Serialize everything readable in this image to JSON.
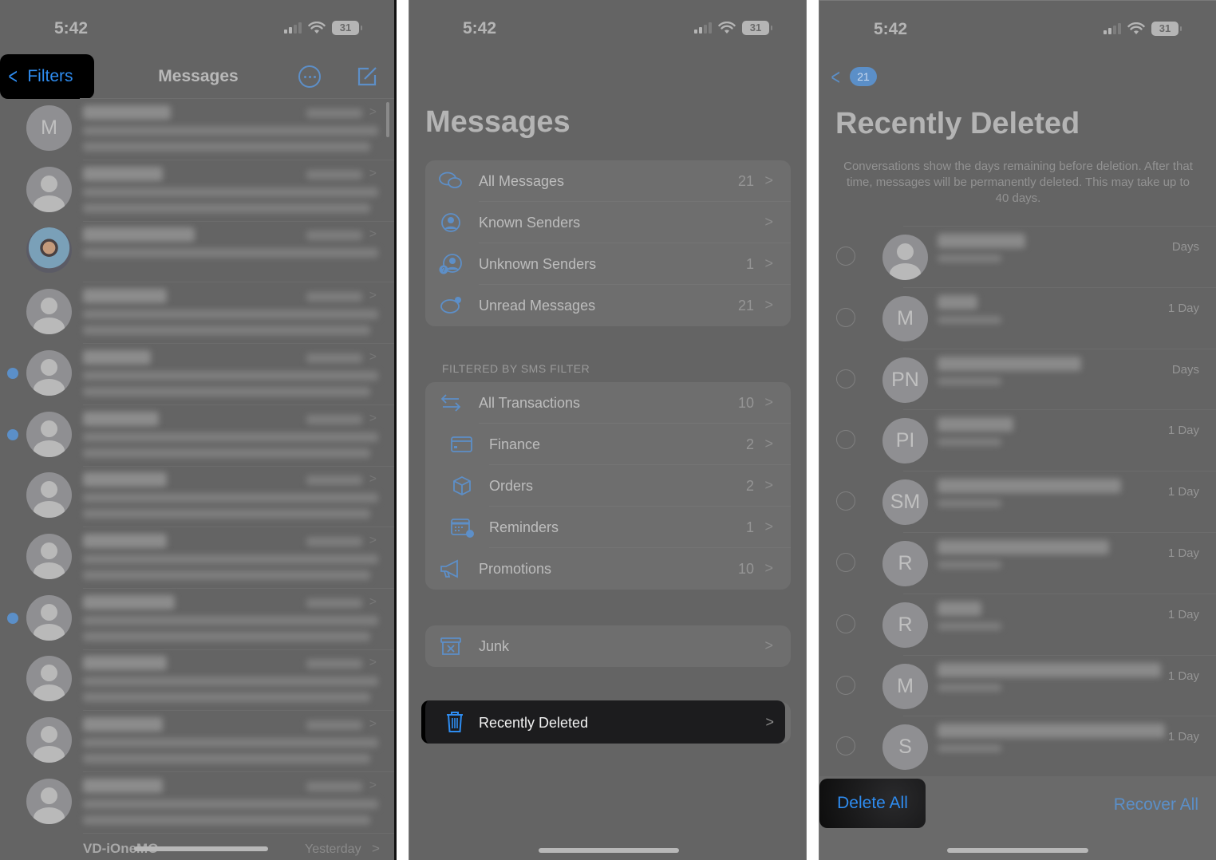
{
  "status_bar": {
    "time": "5:42",
    "battery": "31"
  },
  "panel1": {
    "back_label": "Filters",
    "title": "Messages",
    "conversations": [
      {
        "avatar": "M",
        "unread": false,
        "photo": false
      },
      {
        "avatar": "",
        "unread": false,
        "photo": false
      },
      {
        "avatar": "",
        "unread": false,
        "photo": true
      },
      {
        "avatar": "",
        "unread": false,
        "photo": false
      },
      {
        "avatar": "",
        "unread": true,
        "photo": false
      },
      {
        "avatar": "",
        "unread": true,
        "photo": false
      },
      {
        "avatar": "",
        "unread": false,
        "photo": false
      },
      {
        "avatar": "",
        "unread": false,
        "photo": false
      },
      {
        "avatar": "",
        "unread": true,
        "photo": false
      },
      {
        "avatar": "",
        "unread": false,
        "photo": false
      },
      {
        "avatar": "",
        "unread": false,
        "photo": false
      },
      {
        "avatar": "",
        "unread": false,
        "photo": false
      }
    ],
    "last_visible": {
      "name": "VD-iOneMO",
      "time": "Yesterday"
    }
  },
  "panel2": {
    "title": "Messages",
    "main_filters": [
      {
        "label": "All Messages",
        "count": "21",
        "icon": "chat-bubbles-icon"
      },
      {
        "label": "Known Senders",
        "count": "",
        "icon": "person-circle-icon"
      },
      {
        "label": "Unknown Senders",
        "count": "1",
        "icon": "unknown-person-icon"
      },
      {
        "label": "Unread Messages",
        "count": "21",
        "icon": "unread-bubble-icon"
      }
    ],
    "section_header": "FILTERED BY SMS FILTER",
    "sms_filters": [
      {
        "label": "All Transactions",
        "count": "10",
        "icon": "arrows-exchange-icon",
        "indent": false
      },
      {
        "label": "Finance",
        "count": "2",
        "icon": "credit-card-icon",
        "indent": true
      },
      {
        "label": "Orders",
        "count": "2",
        "icon": "package-box-icon",
        "indent": true
      },
      {
        "label": "Reminders",
        "count": "1",
        "icon": "calendar-clock-icon",
        "indent": true
      },
      {
        "label": "Promotions",
        "count": "10",
        "icon": "megaphone-icon",
        "indent": false
      }
    ],
    "junk": {
      "label": "Junk"
    },
    "recently_deleted": {
      "label": "Recently Deleted"
    }
  },
  "panel3": {
    "badge": "21",
    "title": "Recently Deleted",
    "description": "Conversations show the days remaining before deletion. After that time, messages will be permanently deleted. This may take up to 40 days.",
    "items": [
      {
        "avatar": "",
        "days": "Days"
      },
      {
        "avatar": "M",
        "days": "1 Day"
      },
      {
        "avatar": "PN",
        "days": "Days"
      },
      {
        "avatar": "PI",
        "days": "1 Day"
      },
      {
        "avatar": "SM",
        "days": "1 Day"
      },
      {
        "avatar": "R",
        "days": "1 Day"
      },
      {
        "avatar": "R",
        "days": "1 Day"
      },
      {
        "avatar": "M",
        "days": "1 Day"
      },
      {
        "avatar": "S",
        "days": "1 Day"
      }
    ],
    "delete_all": "Delete All",
    "recover_all": "Recover All"
  },
  "colors": {
    "accent": "#2e8cf0",
    "dimmed_accent": "#5b8fc8",
    "overlay": "#646464"
  }
}
